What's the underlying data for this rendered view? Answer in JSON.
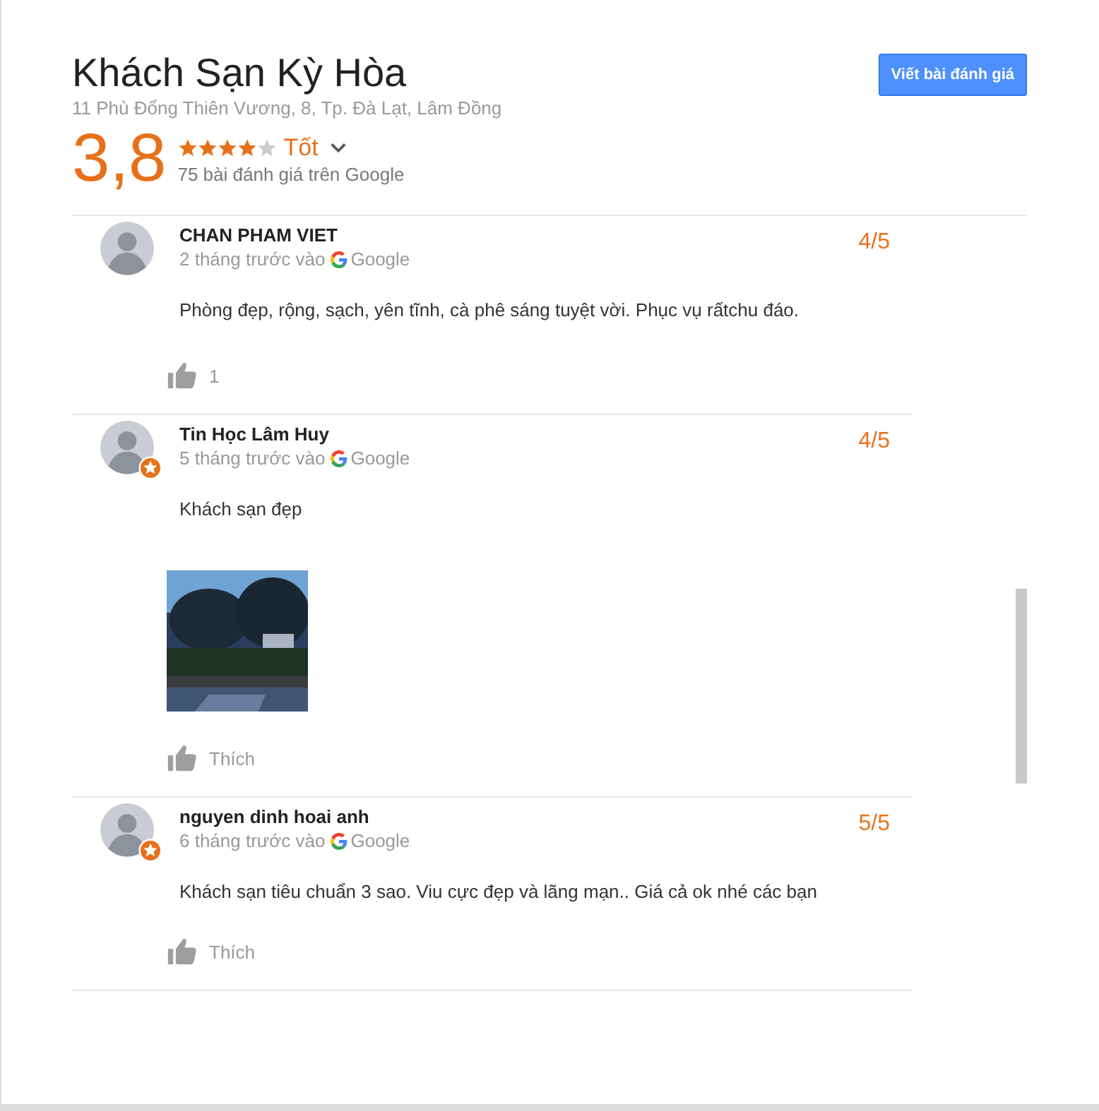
{
  "place": {
    "name": "Khách Sạn Kỳ Hòa",
    "address": "11 Phù Đổng Thiên Vương, 8, Tp. Đà Lạt, Lâm Đồng",
    "write_review_button": "Viết bài đánh giá",
    "score": "3,8",
    "stars": 4,
    "rating_word": "Tốt",
    "review_count": "75 bài đánh giá trên Google"
  },
  "reviews": [
    {
      "author": "CHAN PHAM VIET",
      "time": "2 tháng trước vào",
      "source": "Google",
      "rating": "4/5",
      "local_guide": false,
      "text": "Phòng đẹp, rộng, sạch, yên tĩnh, cà phê sáng tuyệt vời. Phục vụ rấtchu đáo.",
      "likes": "1"
    },
    {
      "author": "Tin Học Lâm Huy",
      "time": "5 tháng trước vào",
      "source": "Google",
      "rating": "4/5",
      "local_guide": true,
      "text": "Khách sạn đẹp",
      "likes": "Thích"
    },
    {
      "author": "nguyen dinh hoai anh",
      "time": "6 tháng trước vào",
      "source": "Google",
      "rating": "5/5",
      "local_guide": true,
      "text": "Khách sạn tiêu chuẩn 3 sao. Viu cực đẹp và lãng mạn.. Giá cả ok nhé các bạn",
      "likes": "Thích"
    }
  ]
}
